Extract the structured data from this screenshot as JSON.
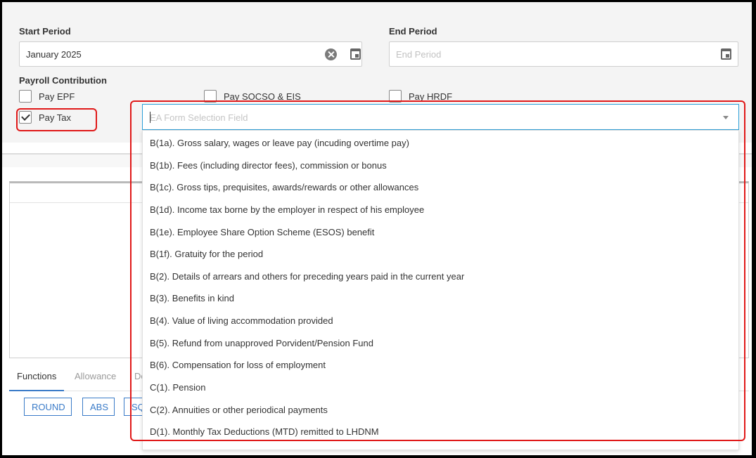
{
  "period": {
    "start_label": "Start Period",
    "start_value": "January 2025",
    "end_label": "End Period",
    "end_placeholder": "End Period"
  },
  "contribution": {
    "title": "Payroll Contribution",
    "options": [
      {
        "label": "Pay EPF",
        "checked": false
      },
      {
        "label": "Pay SOCSO & EIS",
        "checked": false
      },
      {
        "label": "Pay HRDF",
        "checked": false
      },
      {
        "label": "Pay Tax",
        "checked": true
      }
    ]
  },
  "ea_form": {
    "placeholder": "EA Form Selection Field",
    "options": [
      "B(1a). Gross salary, wages or leave pay (incuding overtime pay)",
      "B(1b). Fees (including director fees), commission or bonus",
      "B(1c). Gross tips, prequisites, awards/rewards or other allowances",
      "B(1d). Income tax borne by the employer in respect of his employee",
      "B(1e). Employee Share Option Scheme (ESOS) benefit",
      "B(1f). Gratuity for the period",
      "B(2). Details of arrears and others for preceding years paid in the current year",
      "B(3). Benefits in kind",
      "B(4). Value of living accommodation provided",
      "B(5). Refund from unapproved Porvident/Pension Fund",
      "B(6). Compensation for loss of employment",
      "C(1). Pension",
      "C(2). Annuities or other periodical payments",
      "D(1). Monthly Tax Deductions (MTD) remitted to LHDNM"
    ]
  },
  "tabs": [
    "Functions",
    "Allowance",
    "De"
  ],
  "functions": [
    "ROUND",
    "ABS",
    "SQ"
  ],
  "icons": {
    "clear": "clear-circle-icon",
    "calendar": "calendar-icon",
    "dropdown": "triangle-down-icon",
    "check": "checkmark-icon"
  },
  "colors": {
    "accent": "#3a7bc8",
    "focus_border": "#2b9fd8",
    "highlight": "#e01818"
  }
}
